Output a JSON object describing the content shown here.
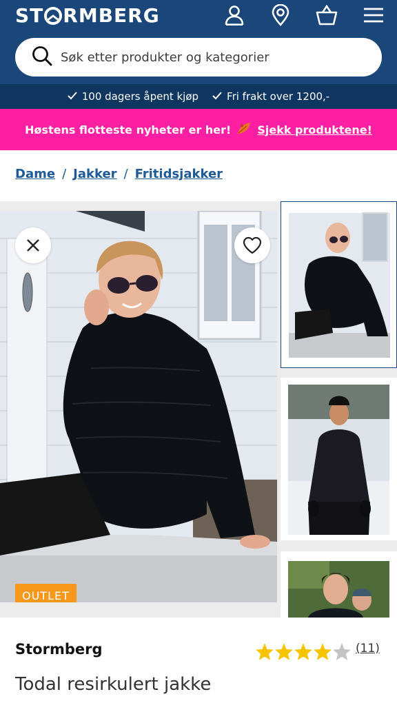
{
  "header": {
    "logo_text": "STORMBERG",
    "icons": [
      "user-icon",
      "location-pin-icon",
      "shopping-basket-icon",
      "menu-icon"
    ],
    "background_color": "#1b4679"
  },
  "search": {
    "placeholder": "Søk etter produkter og kategorier"
  },
  "usp": {
    "items": [
      "100 dagers åpent kjøp",
      "Fri frakt over 1200,-"
    ]
  },
  "promo": {
    "text": "Høstens flotteste nyheter er her!",
    "link_label": "Sjekk produktene!",
    "background_color": "#ff1fa3"
  },
  "breadcrumb": {
    "items": [
      "Dame",
      "Jakker",
      "Fritidsjakker"
    ],
    "separator": "/"
  },
  "gallery": {
    "badge": "OUTLET",
    "badge_color": "#f7981d",
    "thumbnail_count": 3
  },
  "product": {
    "brand": "Stormberg",
    "rating": 4,
    "rating_max": 5,
    "review_count": "(11)",
    "title": "Todal resirkulert jakke"
  }
}
